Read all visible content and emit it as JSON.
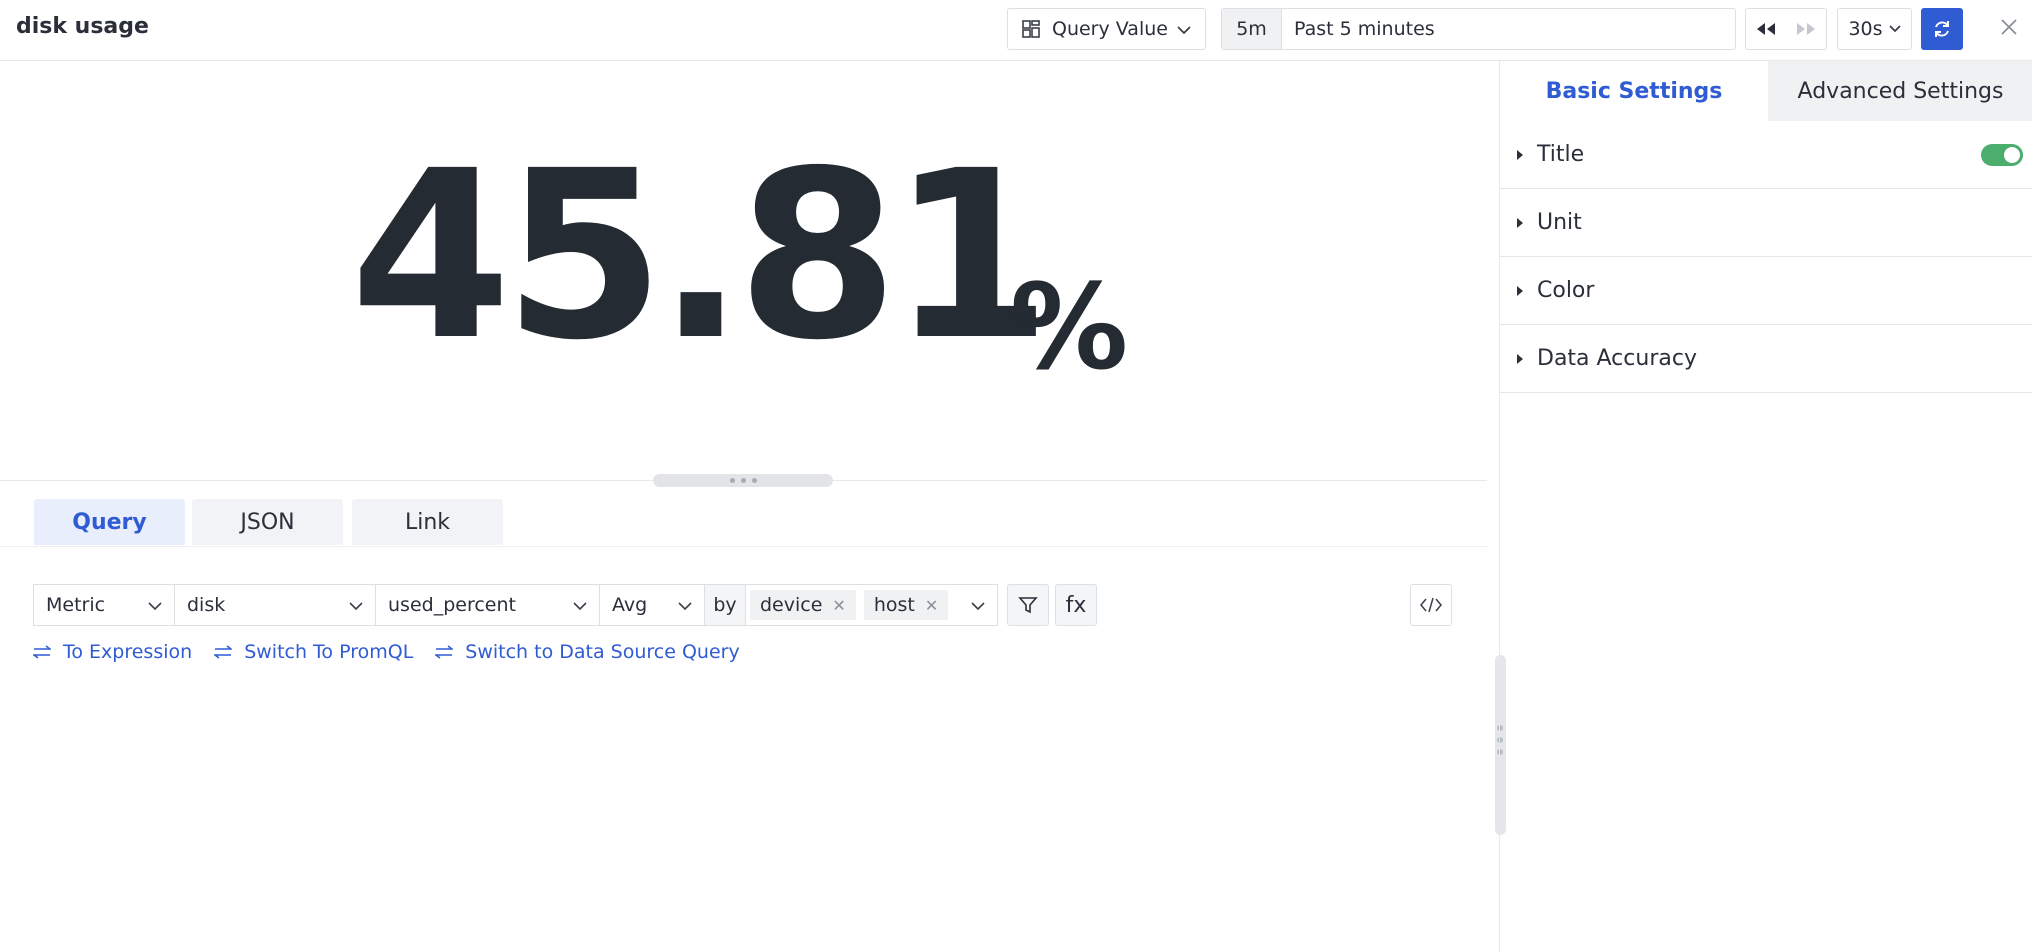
{
  "header": {
    "title": "disk usage",
    "viz_type": "Query Value",
    "time_short": "5m",
    "time_label": "Past 5 minutes",
    "refresh_interval": "30s"
  },
  "preview": {
    "value": "45.81",
    "unit": "%"
  },
  "query_tabs": [
    {
      "label": "Query",
      "active": true
    },
    {
      "label": "JSON",
      "active": false
    },
    {
      "label": "Link",
      "active": false
    }
  ],
  "query": {
    "source": "Metric",
    "measurement": "disk",
    "field": "used_percent",
    "aggregation": "Avg",
    "by_label": "by",
    "group_tags": [
      "device",
      "host"
    ],
    "fx_label": "fx"
  },
  "switch_links": [
    "To Expression",
    "Switch To PromQL",
    "Switch to Data Source Query"
  ],
  "side_panel": {
    "tabs": [
      "Basic Settings",
      "Advanced Settings"
    ],
    "sections": [
      "Title",
      "Unit",
      "Color",
      "Data Accuracy"
    ],
    "title_enabled": true
  },
  "colors": {
    "accent": "#2f5bd3",
    "toggle_on": "#4cae6e",
    "value_text": "#242b33"
  }
}
